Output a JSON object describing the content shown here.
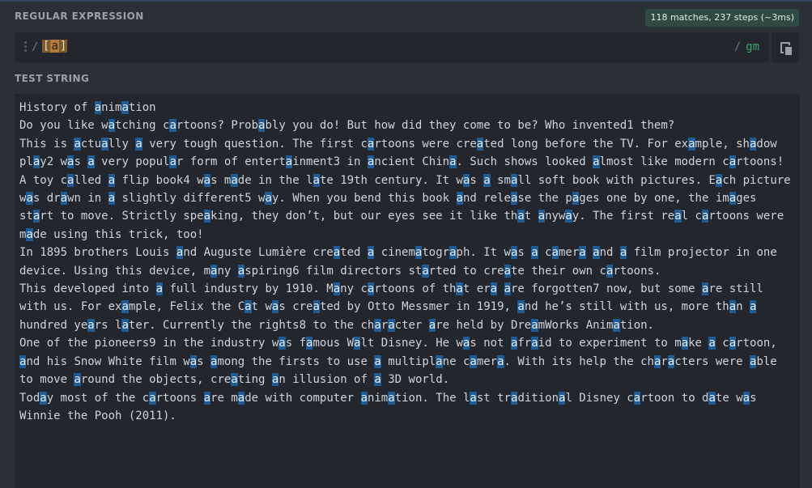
{
  "regex": {
    "title": "REGULAR EXPRESSION",
    "delimiter_left": "/",
    "pattern_open": "[",
    "pattern_char": "a",
    "pattern_close": "]",
    "delimiter_right": "/",
    "flags": "gm"
  },
  "match_info": "118 matches, 237 steps (~3ms)",
  "test": {
    "title": "TEST STRING",
    "lines": [
      "History of animation",
      "Do you like watching cartoons? Probably you do! But how did they come to be? Who invented1 them?",
      "This is actually a very tough question. The first cartoons were created long before the TV. For example, shadow play2 was a very popular form of entertainment3 in ancient China. Such shows looked almost like modern cartoons!",
      "A toy called a flip book4 was made in the late 19th century. It was a small soft book with pictures. Each picture was drawn in a slightly different5 way. When you bend this book and release the pages one by one, the images start to move. Strictly speaking, they don’t, but our eyes see it like that anyway. The first real cartoons were made using this trick, too!",
      "In 1895 brothers Louis and Auguste Lumière created a cinematograph. It was a camera and a film projector in one device. Using this device, many aspiring6 film directors started to create their own cartoons.",
      "This developed into a full industry by 1910. Many cartoons of that era are forgotten7 now, but some are still with us. For example, Felix the Cat was created by Otto Messmer in 1919, and he’s still with us, more than a hundred years later. Currently the rights8 to the character are held by DreamWorks Animation.",
      "One of the pioneers9 in the industry was famous Walt Disney. He was not afraid to experiment to make a cartoon, and his Snow White film was among the firsts to use a multiplane camera. With its help the characters were able to move around the objects, creating an illusion of a 3D world.",
      "Today most of the cartoons are made with computer animation. The last traditional Disney cartoon to date was Winnie the Pooh (2011)."
    ]
  },
  "icons": {
    "copy": "copy-icon",
    "drag": "drag-handle-icon"
  },
  "colors": {
    "match_highlight": "#1f5b95",
    "flags": "#3fa36b",
    "badge_bg": "#2f4a42"
  }
}
